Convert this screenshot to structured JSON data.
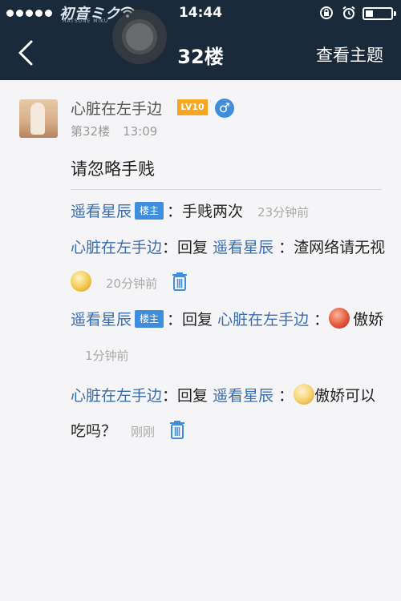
{
  "status_bar": {
    "carrier": "初音ミク",
    "carrier_sub": "HATSUNE MIKU",
    "time": "14:44",
    "battery_level": 0.3
  },
  "nav": {
    "title": "32楼",
    "action": "查看主题"
  },
  "post": {
    "username": "心脏在左手边",
    "level": "LV10",
    "gender_symbol": "♂",
    "floor": "第32楼",
    "time": "13:09",
    "content": "请忽略手贱"
  },
  "replies": [
    {
      "user": "遥看星辰",
      "tag": "楼主",
      "text": "：手贱两次",
      "time": "23分钟前"
    },
    {
      "user": "心脏在左手边",
      "reply_prefix": "：回复 ",
      "reply_to": "遥看星辰",
      "text_before": " ：渣网络请无视",
      "time": "20分钟前"
    },
    {
      "user": "遥看星辰",
      "tag": "楼主",
      "reply_prefix": "：回复 ",
      "reply_to": "心脏在左手边",
      "text_before": " ：",
      "text_after": "傲娇",
      "time": "1分钟前"
    },
    {
      "user": "心脏在左手边",
      "reply_prefix": "：回复 ",
      "reply_to": "遥看星辰",
      "text_before": " ：",
      "text_after": "傲娇可以吃吗？",
      "time": "刚刚"
    }
  ],
  "colors": {
    "nav_bg": "#1b2a3a",
    "link_blue": "#3a6cb0",
    "tag_blue": "#3f8ede",
    "level_orange": "#f5a623"
  }
}
